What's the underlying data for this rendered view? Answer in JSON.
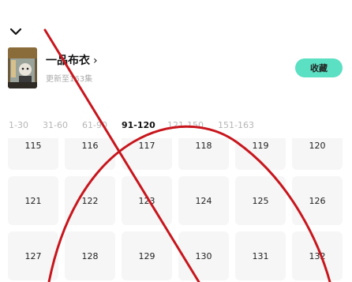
{
  "header": {
    "collapse_icon": "chevron-down-icon"
  },
  "drama": {
    "title": "一品布衣",
    "title_chevron": "›",
    "update_status": "更新至163集",
    "collect_label": "收藏"
  },
  "episode_ranges": [
    {
      "label": "1-30",
      "active": false
    },
    {
      "label": "31-60",
      "active": false
    },
    {
      "label": "61-90",
      "active": false
    },
    {
      "label": "91-120",
      "active": true
    },
    {
      "label": "121-150",
      "active": false
    },
    {
      "label": "151-163",
      "active": false
    }
  ],
  "episodes": [
    "115",
    "116",
    "117",
    "118",
    "119",
    "120",
    "121",
    "122",
    "123",
    "124",
    "125",
    "126",
    "127",
    "128",
    "129",
    "130",
    "131",
    "132"
  ],
  "colors": {
    "accent": "#5be0c3",
    "annotation": "#c8161d",
    "cell_bg": "#f6f6f6"
  }
}
